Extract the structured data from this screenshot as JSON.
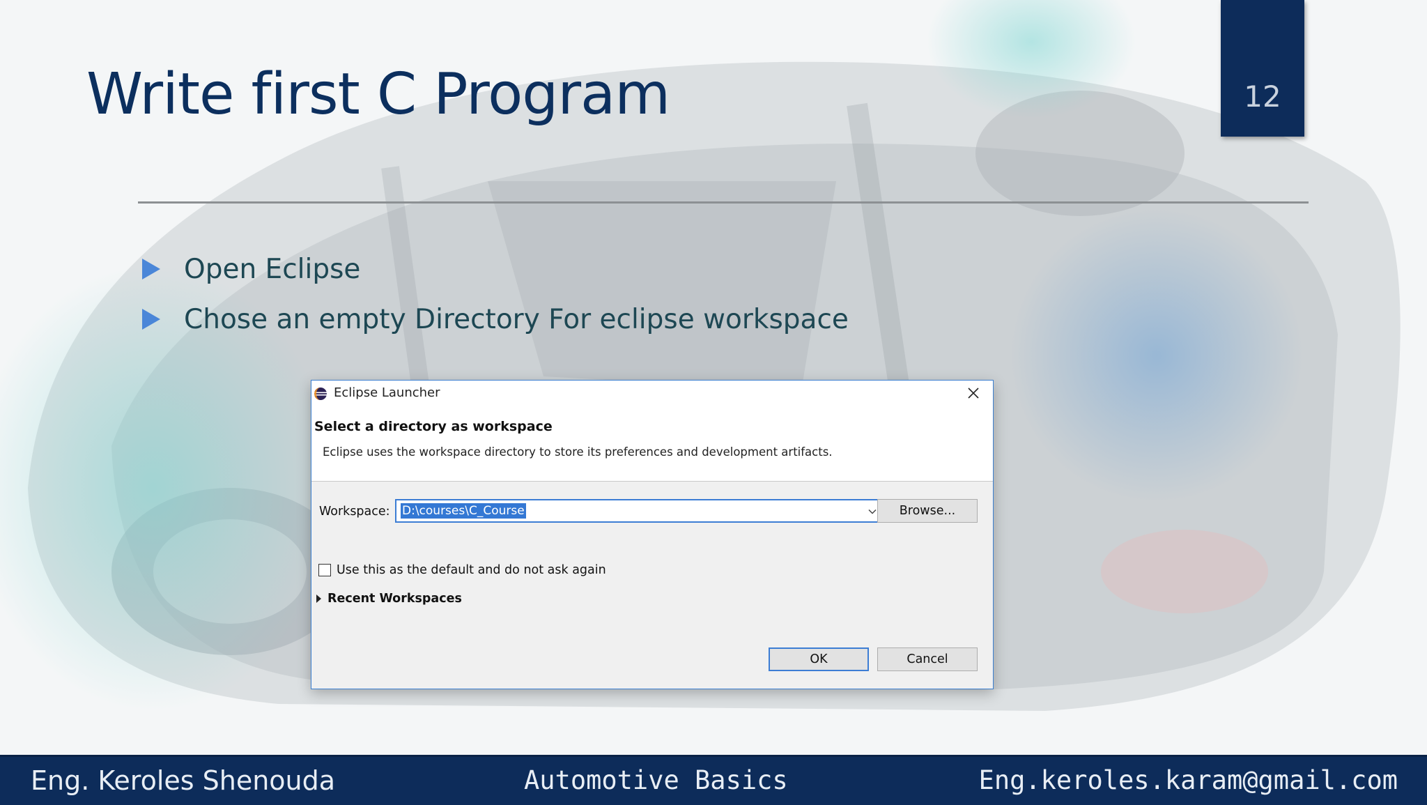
{
  "slide": {
    "title": "Write first C Program",
    "page_number": "12",
    "bullets": [
      "Open Eclipse",
      "Chose an empty Directory For eclipse workspace"
    ]
  },
  "footer": {
    "left": "Eng. Keroles Shenouda",
    "center": "Automotive Basics",
    "right": "Eng.keroles.karam@gmail.com"
  },
  "dialog": {
    "window_title": "Eclipse Launcher",
    "heading": "Select a directory as workspace",
    "description": "Eclipse uses the workspace directory to store its preferences and development artifacts.",
    "workspace_label": "Workspace:",
    "workspace_value": "D:\\courses\\C_Course",
    "browse_label": "Browse...",
    "checkbox_label": "Use this as the default and do not ask again",
    "recent_label": "Recent Workspaces",
    "ok_label": "OK",
    "cancel_label": "Cancel"
  },
  "colors": {
    "brand_navy": "#0d2c5a",
    "title_blue": "#0c2f5e",
    "bullet_arrow": "#4a86d8",
    "focus_blue": "#3c7dd4"
  }
}
